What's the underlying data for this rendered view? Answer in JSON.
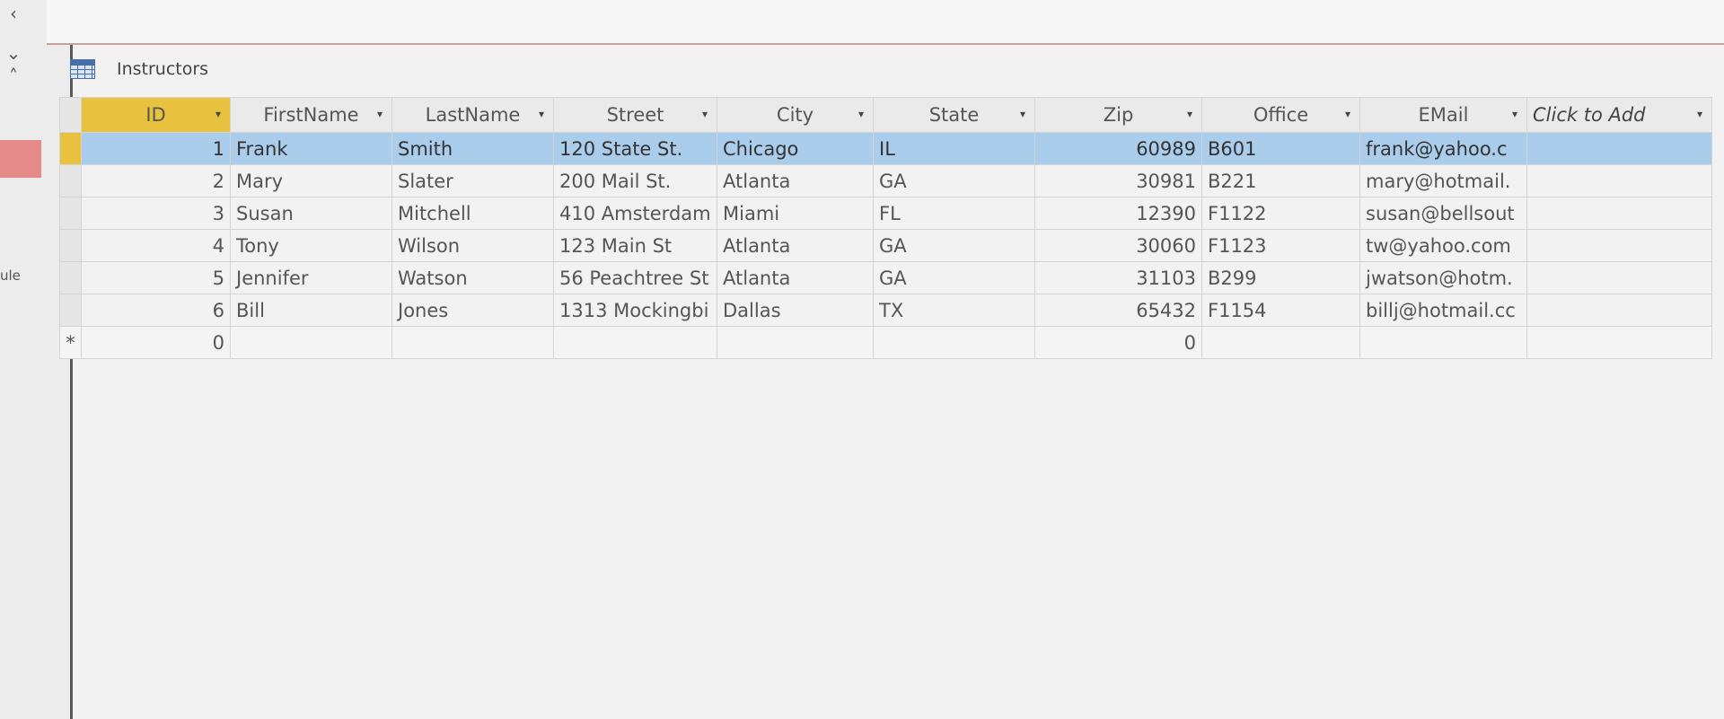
{
  "document": {
    "tab_title": "Instructors"
  },
  "nav": {
    "partial_label": "ule"
  },
  "table": {
    "columns": [
      "ID",
      "FirstName",
      "LastName",
      "Street",
      "City",
      "State",
      "Zip",
      "Office",
      "EMail",
      "Click to Add"
    ],
    "rows": [
      [
        "1",
        "Frank",
        "Smith",
        "120 State St.",
        "Chicago",
        "IL",
        "60989",
        "B601",
        "frank@yahoo.c"
      ],
      [
        "2",
        "Mary",
        "Slater",
        "200 Mail St.",
        "Atlanta",
        "GA",
        "30981",
        "B221",
        "mary@hotmail."
      ],
      [
        "3",
        "Susan",
        "Mitchell",
        "410 Amsterdam",
        "Miami",
        "FL",
        "12390",
        "F1122",
        "susan@bellsout"
      ],
      [
        "4",
        "Tony",
        "Wilson",
        "123 Main St",
        "Atlanta",
        "GA",
        "30060",
        "F1123",
        "tw@yahoo.com"
      ],
      [
        "5",
        "Jennifer",
        "Watson",
        "56 Peachtree St",
        "Atlanta",
        "GA",
        "31103",
        "B299",
        "jwatson@hotm."
      ],
      [
        "6",
        "Bill",
        "Jones",
        "1313 Mockingbi",
        "Dallas",
        "TX",
        "65432",
        "F1154",
        "billj@hotmail.cc"
      ]
    ],
    "new_row": {
      "marker": "*",
      "id": "0",
      "zip": "0"
    }
  }
}
